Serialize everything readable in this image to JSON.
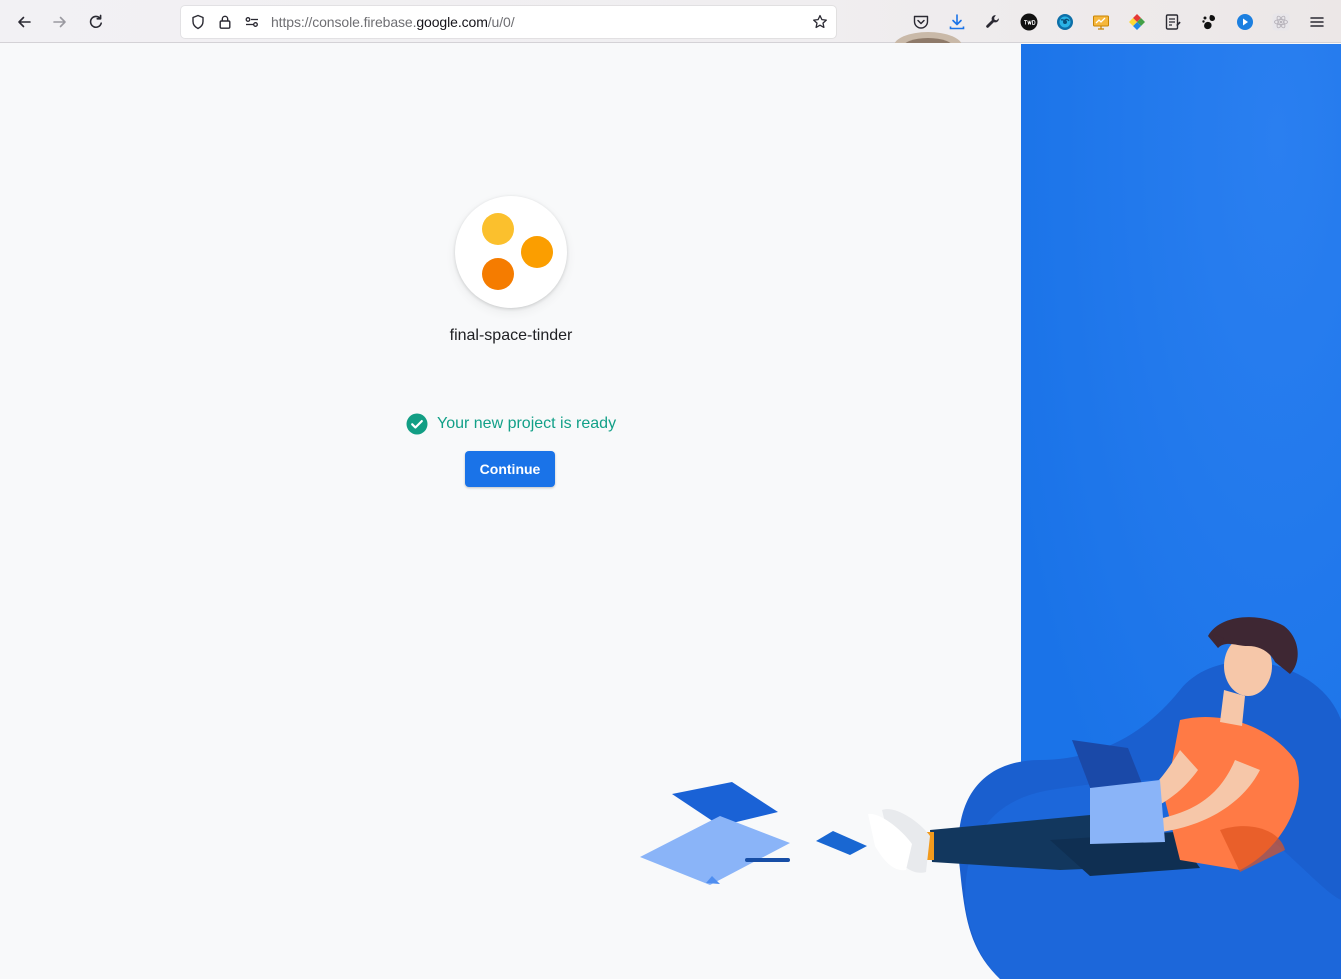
{
  "browser": {
    "url_prefix": "https://console.",
    "url_domain_pre": "firebase.",
    "url_domain": "google.com",
    "url_path": "/u/0/"
  },
  "icons": {
    "back": "back-arrow-icon",
    "forward": "forward-arrow-icon",
    "reload": "reload-icon",
    "tracking": "shield-icon",
    "lock": "lock-icon",
    "permissions": "permissions-icon",
    "bookmark": "star-icon",
    "pocket": "pocket-icon",
    "downloads": "download-icon",
    "devtools": "wrench-icon",
    "menu": "hamburger-menu-icon"
  },
  "project": {
    "name": "final-space-tinder",
    "dot_colors": [
      "#fbc02d",
      "#fb9e00",
      "#f57c00"
    ]
  },
  "status": {
    "text": "Your new project is ready"
  },
  "actions": {
    "continue_label": "Continue"
  },
  "colors": {
    "accent": "#1a73e8",
    "success": "#129e84",
    "page_bg": "#f8f9fa"
  }
}
